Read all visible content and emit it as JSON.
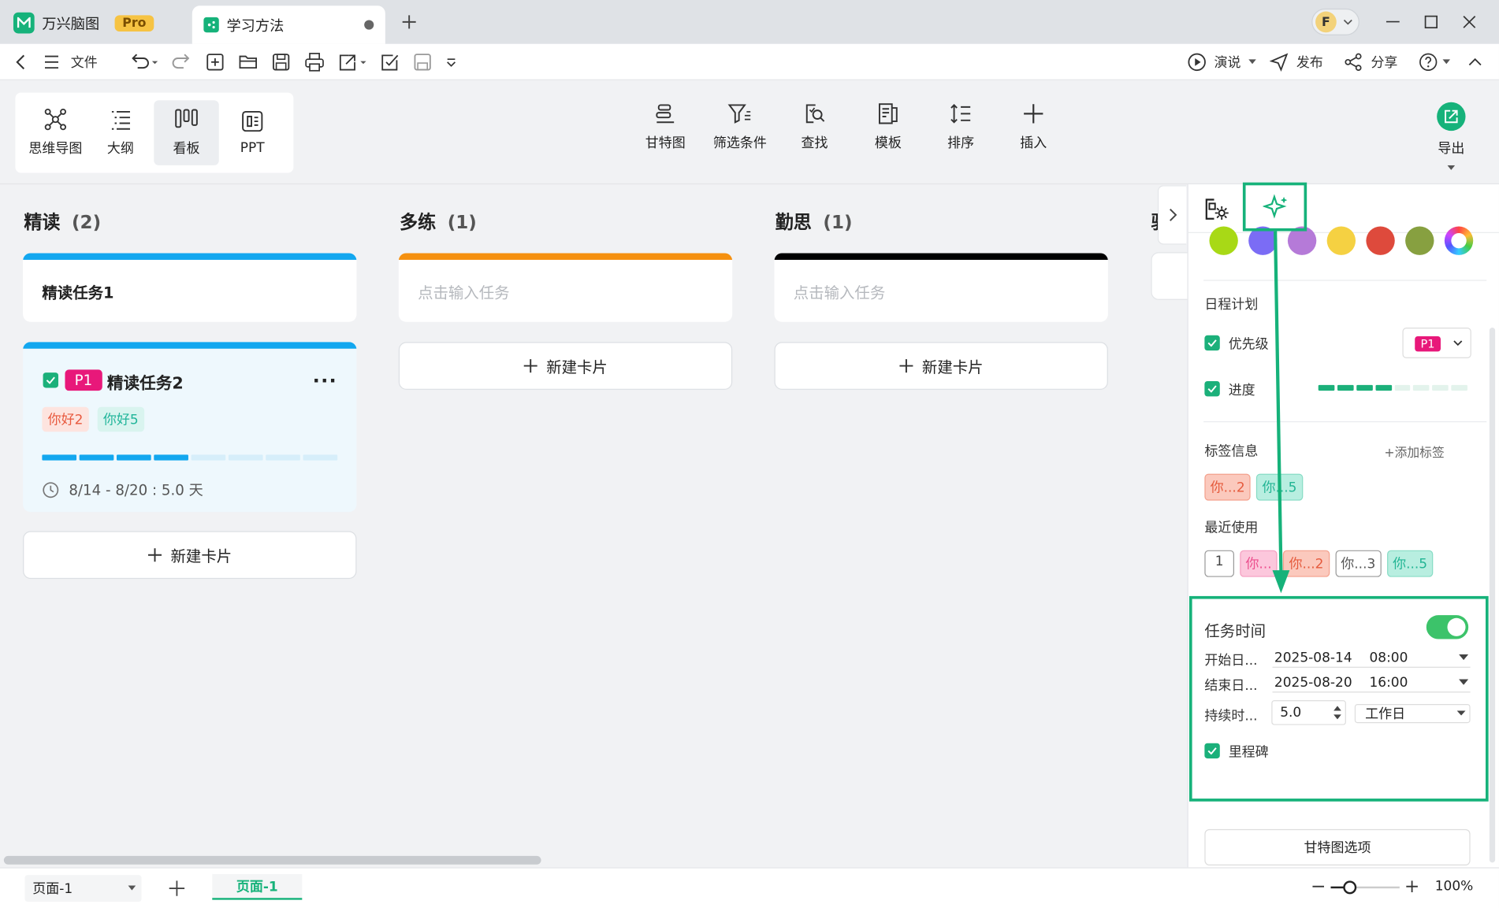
{
  "tabs": {
    "app_name": "万兴脑图",
    "pro_badge": "Pro",
    "doc_name": "学习方法"
  },
  "avatar_letter": "F",
  "menubar": {
    "file_label": "文件",
    "present_label": "演说",
    "publish_label": "发布",
    "share_label": "分享"
  },
  "views": [
    {
      "label": "思维导图",
      "icon": "mindmap-icon"
    },
    {
      "label": "大纲",
      "icon": "outline-icon"
    },
    {
      "label": "看板",
      "icon": "kanban-icon"
    },
    {
      "label": "PPT",
      "icon": "ppt-icon"
    }
  ],
  "tools": [
    {
      "label": "甘特图",
      "icon": "gantt-icon"
    },
    {
      "label": "筛选条件",
      "icon": "filter-icon"
    },
    {
      "label": "查找",
      "icon": "find-icon"
    },
    {
      "label": "模板",
      "icon": "template-icon"
    },
    {
      "label": "排序",
      "icon": "sort-icon"
    },
    {
      "label": "插入",
      "icon": "plus-icon"
    }
  ],
  "export_label": "导出",
  "columns": [
    {
      "title": "精读",
      "count": "(2)",
      "color": "#13a7ef"
    },
    {
      "title": "多练",
      "count": "(1)",
      "color": "#f5900f"
    },
    {
      "title": "勤思",
      "count": "(1)",
      "color": "#000000"
    }
  ],
  "partial_column_char": "验",
  "cards": {
    "card1_title": "精读任务1",
    "card2_priority": "P1",
    "card2_title": "精读任务2",
    "card2_tags": [
      "你好2",
      "你好5"
    ],
    "card2_progress": 0.5,
    "card2_date": "8/14 - 8/20 : 5.0 天",
    "placeholder": "点击输入任务"
  },
  "new_card_label": "新建卡片",
  "panel": {
    "colors": [
      "#a8d916",
      "#7b6cf5",
      "#b57ad8",
      "#f5d142",
      "#de4a3c",
      "#87a040",
      "rainbow"
    ],
    "schedule_title": "日程计划",
    "priority_label": "优先级",
    "priority_value": "P1",
    "progress_label": "进度",
    "progress_value": 0.5,
    "tags_title": "标签信息",
    "add_tag_label": "+添加标签",
    "current_tags": [
      "你...2",
      "你...5"
    ],
    "recent_title": "最近使用",
    "recent_tags": [
      "1",
      "你...",
      "你...2",
      "你...3",
      "你...5"
    ],
    "task_time_title": "任务时间",
    "start_label": "开始日...",
    "start_date": "2025-08-14",
    "start_time": "08:00",
    "end_label": "结束日...",
    "end_date": "2025-08-20",
    "end_time": "16:00",
    "duration_label": "持续时...",
    "duration_value": "5.0",
    "duration_unit": "工作日",
    "milestone_label": "里程碑",
    "gantt_options_label": "甘特图选项"
  },
  "statusbar": {
    "page_select": "页面-1",
    "page_tab": "页面-1",
    "zoom": "100%"
  },
  "accent": "#16b27a"
}
